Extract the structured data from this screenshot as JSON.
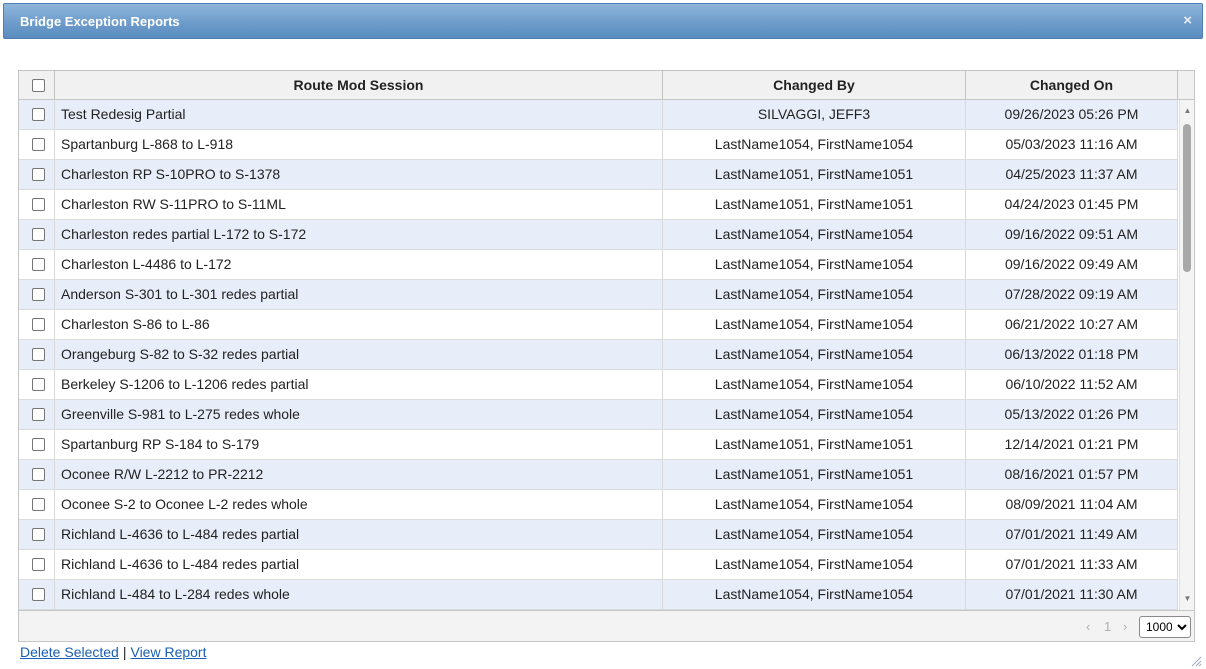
{
  "window": {
    "title": "Bridge Exception Reports",
    "close_icon": "×"
  },
  "grid": {
    "columns": {
      "route": "Route Mod Session",
      "by": "Changed By",
      "on": "Changed On"
    },
    "rows": [
      {
        "route": "Test Redesig Partial",
        "by": "SILVAGGI, JEFF3",
        "on": "09/26/2023 05:26 PM"
      },
      {
        "route": "Spartanburg L-868 to L-918",
        "by": "LastName1054, FirstName1054",
        "on": "05/03/2023 11:16 AM"
      },
      {
        "route": "Charleston RP S-10PRO to S-1378",
        "by": "LastName1051, FirstName1051",
        "on": "04/25/2023 11:37 AM"
      },
      {
        "route": "Charleston RW S-11PRO to S-11ML",
        "by": "LastName1051, FirstName1051",
        "on": "04/24/2023 01:45 PM"
      },
      {
        "route": "Charleston redes partial L-172 to S-172",
        "by": "LastName1054, FirstName1054",
        "on": "09/16/2022 09:51 AM"
      },
      {
        "route": "Charleston L-4486 to L-172",
        "by": "LastName1054, FirstName1054",
        "on": "09/16/2022 09:49 AM"
      },
      {
        "route": "Anderson S-301 to L-301 redes partial",
        "by": "LastName1054, FirstName1054",
        "on": "07/28/2022 09:19 AM"
      },
      {
        "route": "Charleston S-86 to L-86",
        "by": "LastName1054, FirstName1054",
        "on": "06/21/2022 10:27 AM"
      },
      {
        "route": "Orangeburg S-82 to S-32 redes partial",
        "by": "LastName1054, FirstName1054",
        "on": "06/13/2022 01:18 PM"
      },
      {
        "route": "Berkeley S-1206 to L-1206 redes partial",
        "by": "LastName1054, FirstName1054",
        "on": "06/10/2022 11:52 AM"
      },
      {
        "route": "Greenville S-981 to L-275 redes whole",
        "by": "LastName1054, FirstName1054",
        "on": "05/13/2022 01:26 PM"
      },
      {
        "route": "Spartanburg RP S-184 to S-179",
        "by": "LastName1051, FirstName1051",
        "on": "12/14/2021 01:21 PM"
      },
      {
        "route": "Oconee R/W L-2212 to PR-2212",
        "by": "LastName1051, FirstName1051",
        "on": "08/16/2021 01:57 PM"
      },
      {
        "route": "Oconee S-2 to Oconee L-2 redes whole",
        "by": "LastName1054, FirstName1054",
        "on": "08/09/2021 11:04 AM"
      },
      {
        "route": "Richland L-4636 to L-484 redes partial",
        "by": "LastName1054, FirstName1054",
        "on": "07/01/2021 11:49 AM"
      },
      {
        "route": "Richland L-4636 to L-484 redes partial",
        "by": "LastName1054, FirstName1054",
        "on": "07/01/2021 11:33 AM"
      },
      {
        "route": "Richland L-484 to L-284 redes whole",
        "by": "LastName1054, FirstName1054",
        "on": "07/01/2021 11:30 AM"
      }
    ]
  },
  "pager": {
    "prev": "‹",
    "page": "1",
    "next": "›",
    "page_size": "1000",
    "page_size_options": [
      "1000"
    ]
  },
  "actions": {
    "delete_selected": "Delete Selected",
    "separator": "|",
    "view_report": "View Report"
  },
  "colors": {
    "title_bar": "#6e9ccb",
    "alt_row": "#e8eef9",
    "link": "#1a5fb4"
  }
}
